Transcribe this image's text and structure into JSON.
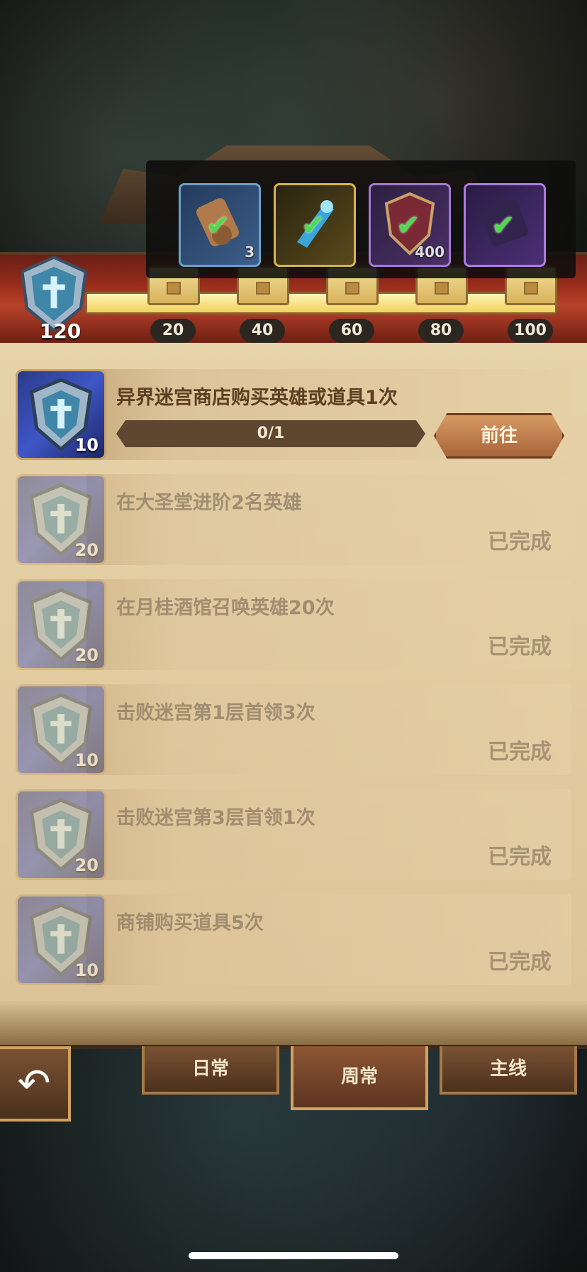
{
  "colors": {
    "panel": "#e0c89c",
    "accent_text": "#5c3f22",
    "done_text": "#8c7a62",
    "check": "#4fdc4a",
    "band": "#9a2d1c"
  },
  "progress": {
    "points": "120",
    "fill_fraction": 1.0,
    "milestones": [
      "20",
      "40",
      "60",
      "80",
      "100"
    ]
  },
  "rewards": [
    {
      "icon": "scroll-icon",
      "qty": "3",
      "claimed": true
    },
    {
      "icon": "cyan-item-icon",
      "qty": "",
      "claimed": true
    },
    {
      "icon": "shield-emblem-icon",
      "qty": "400",
      "claimed": true
    },
    {
      "icon": "dark-scroll-icon",
      "qty": "",
      "claimed": true
    }
  ],
  "tasks": [
    {
      "title": "异界迷宫商店购买英雄或道具1次",
      "points": "10",
      "progress": "0/1",
      "button": "前往",
      "done": false
    },
    {
      "title": "在大圣堂进阶2名英雄",
      "points": "20",
      "status": "已完成",
      "done": true
    },
    {
      "title": "在月桂酒馆召唤英雄20次",
      "points": "20",
      "status": "已完成",
      "done": true
    },
    {
      "title": "击败迷宫第1层首领3次",
      "points": "10",
      "status": "已完成",
      "done": true
    },
    {
      "title": "击败迷宫第3层首领1次",
      "points": "20",
      "status": "已完成",
      "done": true
    },
    {
      "title": "商铺购买道具5次",
      "points": "10",
      "status": "已完成",
      "done": true
    }
  ],
  "tabs": {
    "daily": "日常",
    "weekly": "周常",
    "main": "主线"
  },
  "back_icon": "back-arrow-icon"
}
